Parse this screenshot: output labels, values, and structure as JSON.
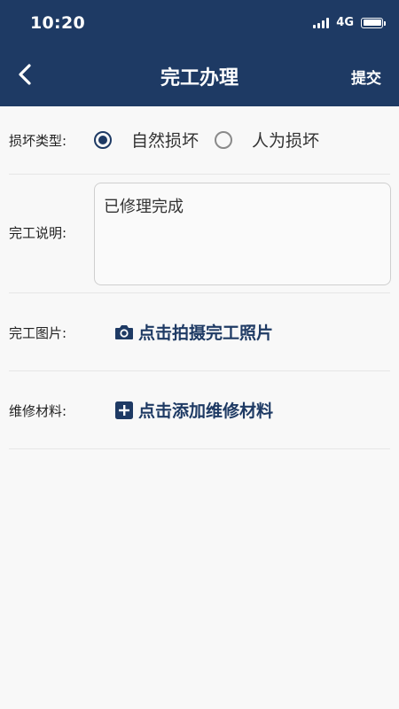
{
  "status_bar": {
    "time": "10:20",
    "network": "4G"
  },
  "header": {
    "title": "完工办理",
    "submit_label": "提交",
    "back_icon": "chevron-left-icon"
  },
  "form": {
    "damage_type": {
      "label": "损坏类型:",
      "options": [
        {
          "label": "自然损坏",
          "checked": true
        },
        {
          "label": "人为损坏",
          "checked": false
        }
      ]
    },
    "completion_desc": {
      "label": "完工说明:",
      "value": "已修理完成"
    },
    "completion_photo": {
      "label": "完工图片:",
      "action_label": "点击拍摄完工照片",
      "icon": "camera-icon"
    },
    "materials": {
      "label": "维修材料:",
      "action_label": "点击添加维修材料",
      "icon": "plus-square-icon"
    }
  },
  "colors": {
    "primary": "#1e3a64",
    "background": "#f8f8f8"
  }
}
